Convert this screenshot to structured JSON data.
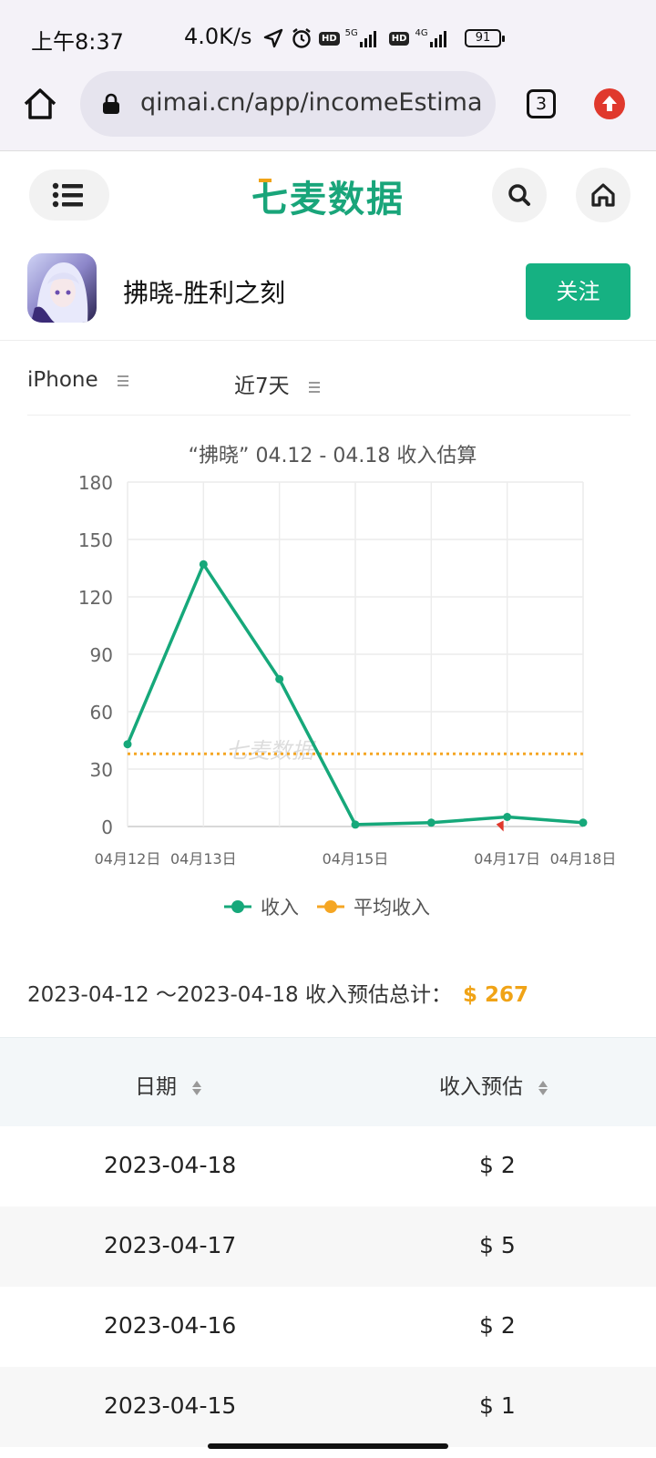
{
  "status_bar": {
    "time": "上午8:37",
    "speed": "4.0K/s",
    "net1": "5G",
    "net2": "4G",
    "hd": "HD",
    "battery": "91"
  },
  "browser": {
    "url": "qimai.cn/app/incomeEstima",
    "tab_count": "3",
    "icons": [
      "home-icon",
      "lock-icon",
      "tabs-icon",
      "upgrade-icon"
    ]
  },
  "site": {
    "logo": "七麦数据",
    "brand_color": "#19a57a",
    "icons": [
      "menu-icon",
      "search-icon",
      "home-icon"
    ]
  },
  "app": {
    "name": "拂晓-胜利之刻",
    "follow_label": "关注"
  },
  "filters": {
    "device": "iPhone",
    "range": "近7天"
  },
  "chart_data": {
    "type": "line",
    "title": "“拂晓” 04.12 - 04.18 收入估算",
    "categories": [
      "04月12日",
      "04月13日",
      "04月14日",
      "04月15日",
      "04月16日",
      "04月17日",
      "04月18日"
    ],
    "x_tick_labels_shown": [
      "04月12日",
      "04月13日",
      "04月15日",
      "04月17日",
      "04月18日"
    ],
    "series": [
      {
        "name": "收入",
        "color": "#16a87a",
        "values": [
          43,
          137,
          77,
          1,
          2,
          5,
          2
        ]
      },
      {
        "name": "平均收入",
        "color": "#f5a623",
        "values": [
          38,
          38,
          38,
          38,
          38,
          38,
          38
        ]
      }
    ],
    "yticks": [
      0,
      30,
      60,
      90,
      120,
      150,
      180
    ],
    "ylim": [
      0,
      180
    ],
    "grid": true,
    "legend_position": "bottom",
    "watermark": "七麦数据"
  },
  "total": {
    "label": "2023-04-12 ～2023-04-18 收入预估总计：",
    "value": "$ 267"
  },
  "table": {
    "headers": [
      "日期",
      "收入预估"
    ],
    "rows": [
      {
        "date": "2023-04-18",
        "income": "$ 2"
      },
      {
        "date": "2023-04-17",
        "income": "$ 5"
      },
      {
        "date": "2023-04-16",
        "income": "$ 2"
      },
      {
        "date": "2023-04-15",
        "income": "$ 1"
      }
    ]
  }
}
